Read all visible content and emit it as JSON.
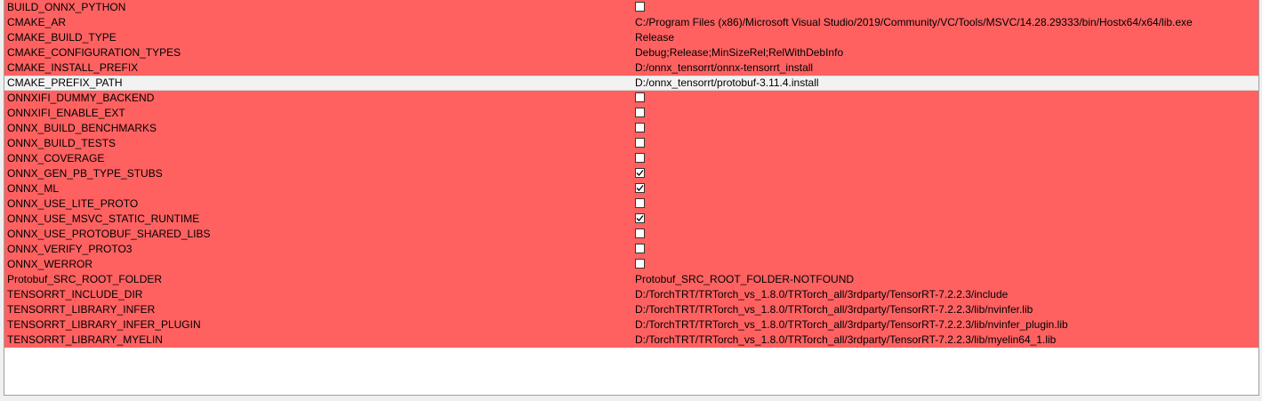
{
  "colors": {
    "new_entry_background": "#ff6161",
    "selected_row_background": "#f2f2f2",
    "table_background": "#ffffff"
  },
  "rows": [
    {
      "name": "BUILD_ONNX_PYTHON",
      "type": "bool",
      "checked": false,
      "value": "",
      "selected": false
    },
    {
      "name": "CMAKE_AR",
      "type": "text",
      "checked": false,
      "value": "C:/Program Files (x86)/Microsoft Visual Studio/2019/Community/VC/Tools/MSVC/14.28.29333/bin/Hostx64/x64/lib.exe",
      "selected": false
    },
    {
      "name": "CMAKE_BUILD_TYPE",
      "type": "text",
      "checked": false,
      "value": "Release",
      "selected": false
    },
    {
      "name": "CMAKE_CONFIGURATION_TYPES",
      "type": "text",
      "checked": false,
      "value": "Debug;Release;MinSizeRel;RelWithDebInfo",
      "selected": false
    },
    {
      "name": "CMAKE_INSTALL_PREFIX",
      "type": "text",
      "checked": false,
      "value": "D:/onnx_tensorrt/onnx-tensorrt_install",
      "selected": false
    },
    {
      "name": "CMAKE_PREFIX_PATH",
      "type": "text",
      "checked": false,
      "value": "D:/onnx_tensorrt/protobuf-3.11.4.install",
      "selected": true
    },
    {
      "name": "ONNXIFI_DUMMY_BACKEND",
      "type": "bool",
      "checked": false,
      "value": "",
      "selected": false
    },
    {
      "name": "ONNXIFI_ENABLE_EXT",
      "type": "bool",
      "checked": false,
      "value": "",
      "selected": false
    },
    {
      "name": "ONNX_BUILD_BENCHMARKS",
      "type": "bool",
      "checked": false,
      "value": "",
      "selected": false
    },
    {
      "name": "ONNX_BUILD_TESTS",
      "type": "bool",
      "checked": false,
      "value": "",
      "selected": false
    },
    {
      "name": "ONNX_COVERAGE",
      "type": "bool",
      "checked": false,
      "value": "",
      "selected": false
    },
    {
      "name": "ONNX_GEN_PB_TYPE_STUBS",
      "type": "bool",
      "checked": true,
      "value": "",
      "selected": false
    },
    {
      "name": "ONNX_ML",
      "type": "bool",
      "checked": true,
      "value": "",
      "selected": false
    },
    {
      "name": "ONNX_USE_LITE_PROTO",
      "type": "bool",
      "checked": false,
      "value": "",
      "selected": false
    },
    {
      "name": "ONNX_USE_MSVC_STATIC_RUNTIME",
      "type": "bool",
      "checked": true,
      "value": "",
      "selected": false
    },
    {
      "name": "ONNX_USE_PROTOBUF_SHARED_LIBS",
      "type": "bool",
      "checked": false,
      "value": "",
      "selected": false
    },
    {
      "name": "ONNX_VERIFY_PROTO3",
      "type": "bool",
      "checked": false,
      "value": "",
      "selected": false
    },
    {
      "name": "ONNX_WERROR",
      "type": "bool",
      "checked": false,
      "value": "",
      "selected": false
    },
    {
      "name": "Protobuf_SRC_ROOT_FOLDER",
      "type": "text",
      "checked": false,
      "value": "Protobuf_SRC_ROOT_FOLDER-NOTFOUND",
      "selected": false
    },
    {
      "name": "TENSORRT_INCLUDE_DIR",
      "type": "text",
      "checked": false,
      "value": "D:/TorchTRT/TRTorch_vs_1.8.0/TRTorch_all/3rdparty/TensorRT-7.2.2.3/include",
      "selected": false
    },
    {
      "name": "TENSORRT_LIBRARY_INFER",
      "type": "text",
      "checked": false,
      "value": "D:/TorchTRT/TRTorch_vs_1.8.0/TRTorch_all/3rdparty/TensorRT-7.2.2.3/lib/nvinfer.lib",
      "selected": false
    },
    {
      "name": "TENSORRT_LIBRARY_INFER_PLUGIN",
      "type": "text",
      "checked": false,
      "value": "D:/TorchTRT/TRTorch_vs_1.8.0/TRTorch_all/3rdparty/TensorRT-7.2.2.3/lib/nvinfer_plugin.lib",
      "selected": false
    },
    {
      "name": "TENSORRT_LIBRARY_MYELIN",
      "type": "text",
      "checked": false,
      "value": "D:/TorchTRT/TRTorch_vs_1.8.0/TRTorch_all/3rdparty/TensorRT-7.2.2.3/lib/myelin64_1.lib",
      "selected": false
    }
  ]
}
